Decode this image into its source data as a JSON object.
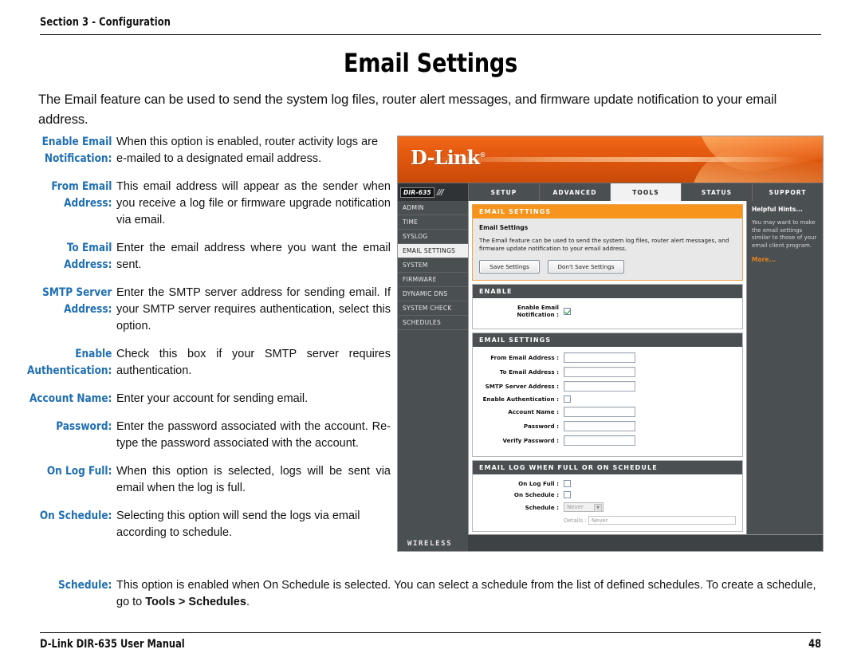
{
  "page": {
    "section": "Section 3 - Configuration",
    "title": "Email Settings",
    "intro": "The Email feature can be used to send the system log files, router alert messages, and firmware update notification to your email address.",
    "footer_left": "D-Link DIR-635 User Manual",
    "footer_page": "48"
  },
  "colors": {
    "label_blue": "#1F6FB3",
    "banner_orange": "#E85C12",
    "panel_orange": "#F7941E",
    "panel_dark": "#4A4F52",
    "hint_link": "#E8821E"
  },
  "descriptions": [
    {
      "label": "Enable Email Notification:",
      "text": "When this option is enabled, router activity logs are e-mailed to a designated email address."
    },
    {
      "label": "From Email Address:",
      "text": "This email address will appear as the sender when you receive a log file or firmware upgrade notification via email."
    },
    {
      "label": "To Email Address:",
      "text": "Enter the email address where you want the email sent."
    },
    {
      "label": "SMTP Server Address:",
      "text": "Enter the SMTP server address for sending email. If your SMTP server requires authentication, select this option."
    },
    {
      "label": "Enable Authentication:",
      "text": "Check this box if your SMTP server requires authentication."
    },
    {
      "label": "Account Name:",
      "text": "Enter your account for sending email."
    },
    {
      "label": "Password:",
      "text": "Enter the password associated with the account. Re-type the password associated with the account."
    },
    {
      "label": "On Log Full:",
      "text": "When this option is selected, logs will be sent via email when the log is full."
    },
    {
      "label": "On Schedule:",
      "text": "Selecting this option will send the logs via email according to schedule."
    }
  ],
  "schedule_note": {
    "label": "Schedule:",
    "text_before": "This option is enabled when On Schedule is selected. You can select a schedule from the list of defined schedules. To create a schedule, go to ",
    "text_bold": "Tools > Schedules",
    "text_after": "."
  },
  "router_ui": {
    "logo": "D-Link",
    "model": "DIR-635",
    "tabs": [
      {
        "label": "SETUP",
        "active": false
      },
      {
        "label": "ADVANCED",
        "active": false
      },
      {
        "label": "TOOLS",
        "active": true
      },
      {
        "label": "STATUS",
        "active": false
      },
      {
        "label": "SUPPORT",
        "active": false
      }
    ],
    "sidebar": [
      {
        "label": "ADMIN",
        "active": false
      },
      {
        "label": "TIME",
        "active": false
      },
      {
        "label": "SYSLOG",
        "active": false
      },
      {
        "label": "EMAIL SETTINGS",
        "active": true
      },
      {
        "label": "SYSTEM",
        "active": false
      },
      {
        "label": "FIRMWARE",
        "active": false
      },
      {
        "label": "DYNAMIC DNS",
        "active": false
      },
      {
        "label": "SYSTEM CHECK",
        "active": false
      },
      {
        "label": "SCHEDULES",
        "active": false
      }
    ],
    "main_panel": {
      "header": "EMAIL SETTINGS",
      "sub_title": "Email Settings",
      "sub_text": "The Email feature can be used to send the system log files, router alert messages, and firmware update notification to your email address.",
      "save_button": "Save Settings",
      "dont_save_button": "Don't Save Settings"
    },
    "enable_panel": {
      "header": "ENABLE",
      "rows": [
        {
          "label": "Enable Email Notification :",
          "type": "checkbox",
          "checked": true
        }
      ]
    },
    "email_settings_panel": {
      "header": "EMAIL SETTINGS",
      "rows": [
        {
          "label": "From Email Address :",
          "type": "text",
          "value": ""
        },
        {
          "label": "To Email Address :",
          "type": "text",
          "value": ""
        },
        {
          "label": "SMTP Server Address :",
          "type": "text",
          "value": ""
        },
        {
          "label": "Enable Authentication :",
          "type": "checkbox",
          "checked": false
        },
        {
          "label": "Account Name :",
          "type": "text",
          "value": ""
        },
        {
          "label": "Password :",
          "type": "text",
          "value": ""
        },
        {
          "label": "Verify Password :",
          "type": "text",
          "value": ""
        }
      ]
    },
    "email_log_panel": {
      "header": "EMAIL LOG WHEN FULL OR ON SCHEDULE",
      "on_log_full_label": "On Log Full :",
      "on_log_full_checked": false,
      "on_schedule_label": "On Schedule :",
      "on_schedule_checked": false,
      "schedule_label": "Schedule :",
      "schedule_value": "Never",
      "details_label": "Details :",
      "details_value": "Never"
    },
    "hints": {
      "title": "Helpful Hints...",
      "text": "You may want to make the email settings similar to those of your email client program.",
      "more": "More..."
    },
    "footer_label": "WIRELESS"
  }
}
